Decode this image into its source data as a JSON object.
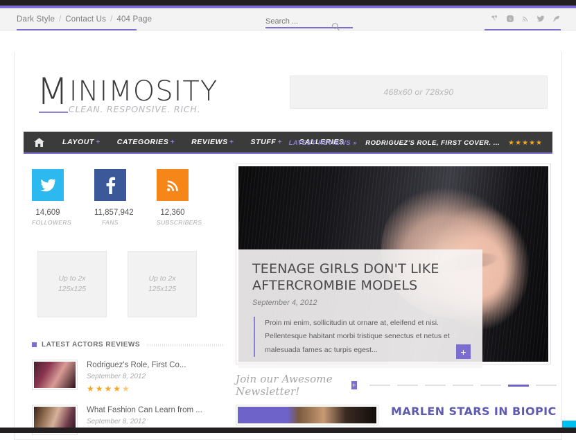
{
  "colors": {
    "accent_purple": "#7a6fd0",
    "nav_dark": "#3b3b3b",
    "star_orange": "#f5a623",
    "twitter_blue": "#2cb9ef",
    "facebook_blue": "#3b5998",
    "rss_orange": "#f78618"
  },
  "utility": {
    "breadcrumb": [
      {
        "label": "Dark Style"
      },
      {
        "label": "Contact Us"
      },
      {
        "label": "404 Page"
      }
    ],
    "separator": "/",
    "search": {
      "placeholder": "Search ...",
      "value": "",
      "icon": "search-icon"
    },
    "social": [
      {
        "name": "vimeo-icon",
        "glyph": "V"
      },
      {
        "name": "skype-icon",
        "glyph": "S"
      },
      {
        "name": "rss-icon",
        "glyph": "◜"
      },
      {
        "name": "twitter-icon",
        "glyph": "ᴠ"
      },
      {
        "name": "feather-icon",
        "glyph": "➤"
      }
    ]
  },
  "header": {
    "logo_cap": "M",
    "logo_rest": "INIMOSITY",
    "tagline": "CLEAN. RESPONSIVE. RICH.",
    "ad_label": "468x60 or 728x90"
  },
  "nav": {
    "home_icon": "home-icon",
    "items": [
      {
        "label": "LAYOUT",
        "has_submenu": true,
        "plus": "+"
      },
      {
        "label": "CATEGORIES",
        "has_submenu": true,
        "plus": "+"
      },
      {
        "label": "REVIEWS",
        "has_submenu": true,
        "plus": "+"
      },
      {
        "label": "STUFF",
        "has_submenu": true,
        "plus": "+"
      },
      {
        "label": "GALLERIES",
        "has_submenu": false,
        "plus": ""
      }
    ],
    "latest_label": "LATEST REVIEWS »",
    "latest_title": "RODRIGUEZ'S ROLE, FIRST COVER. ...",
    "latest_stars": "★★★★★"
  },
  "sidebar": {
    "counters": [
      {
        "icon": "twitter-icon",
        "glyph": "ᴠ",
        "color": "#2cb9ef",
        "number": "14,609",
        "label": "FOLLOWERS"
      },
      {
        "icon": "facebook-icon",
        "glyph": "f",
        "color": "#3b5998",
        "number": "11,857,942",
        "label": "FANS"
      },
      {
        "icon": "rss-icon",
        "glyph": "◜",
        "color": "#f78618",
        "number": "12,360",
        "label": "SUBSCRIBERS"
      }
    ],
    "ad_squares": [
      {
        "line1": "Up to 2x",
        "line2": "125x125"
      },
      {
        "line1": "Up to 2x",
        "line2": "125x125"
      }
    ],
    "widget_title": "LATEST ACTORS REVIEWS",
    "reviews": [
      {
        "title": "Rodriguez's Role, First Co...",
        "date": "September 8, 2012",
        "stars_full": "★★★★",
        "stars_half": "★",
        "thumb": "thumb-a"
      },
      {
        "title": "What Fashion Can Learn from ...",
        "date": "September 8, 2012",
        "stars_full": "",
        "stars_half": "",
        "thumb": "thumb-b"
      }
    ]
  },
  "hero": {
    "title": "TEENAGE GIRLS DON'T LIKE AFTERCROMBIE MODELS",
    "date": "September 4, 2012",
    "excerpt": "Proin mi enim, sollicitudin ut ornare at, eleifend et nisi. Pellentesque habitant morbi tristique senectus et netus et malesuada fames ac turpis egest...",
    "plus_label": "+"
  },
  "newsletter": {
    "text": "Join our Awesome Newsletter!",
    "plus_label": "+",
    "slider_dots": 7,
    "slider_active_index": 5
  },
  "bottom": {
    "peek_title": "MARLEN STARS IN BIOPIC"
  }
}
